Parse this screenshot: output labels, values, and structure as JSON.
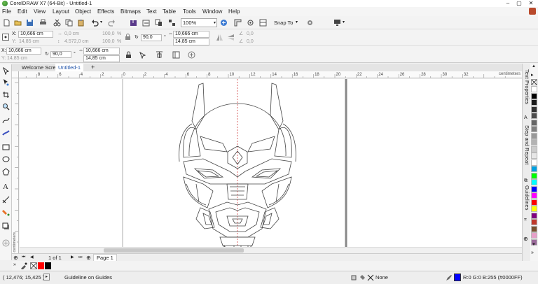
{
  "window": {
    "title": "CorelDRAW X7 (64-Bit) - Untitled-1"
  },
  "menu": [
    "File",
    "Edit",
    "View",
    "Layout",
    "Object",
    "Effects",
    "Bitmaps",
    "Text",
    "Table",
    "Tools",
    "Window",
    "Help"
  ],
  "toolbar": {
    "zoom_value": "100%",
    "snap_label": "Snap To"
  },
  "property_bar": {
    "x_label": "X:",
    "x_value": "10,666 cm",
    "y_label": "Y:",
    "y_value": "14,85 cm",
    "w_value": "0,0 cm",
    "h_value": "4.572,0 cm",
    "scale_w": "100,0",
    "scale_h": "100,0",
    "angle_value": "90,0",
    "x2_value": "10,666 cm",
    "y2_value": "14,85 cm",
    "skew_a": "0,0",
    "skew_b": "0,0"
  },
  "property_bar2": {
    "x_label": "X:",
    "x_value": "10,666 cm",
    "y_label": "Y:",
    "y_value": "14,85 cm",
    "angle_value": "90,0",
    "x2_value": "10,666 cm",
    "y2_value": "14,85 cm"
  },
  "doc_tabs": {
    "welcome": "Welcome Screen",
    "active": "Untitled-1",
    "add": "+"
  },
  "ruler": {
    "units": "centimeters",
    "h_ticks": [
      "8",
      "6",
      "4",
      "2",
      "0",
      "2",
      "4",
      "6",
      "8",
      "10",
      "12",
      "14",
      "16",
      "18",
      "20",
      "22",
      "24",
      "26",
      "28",
      "30",
      "32"
    ],
    "v_units": "centimeters"
  },
  "page_nav": {
    "counter": "1 of 1",
    "page_tab": "Page 1"
  },
  "status": {
    "coords": "( 12,476; 15,425 )",
    "message": "Guideline on Guides",
    "fill": "None",
    "outline": "R:0 G:0 B:255 (#0000FF)"
  },
  "dockers": [
    "Text Properties",
    "Step and Repeat",
    "Guidelines"
  ],
  "colors": {
    "guideline": "#d04040",
    "outline_swatch": "#0000ff",
    "palette": [
      "#ffffff",
      "#000000",
      "#1a1a1a",
      "#333333",
      "#4d4d4d",
      "#666666",
      "#808080",
      "#999999",
      "#b3b3b3",
      "#cccccc",
      "#e6e6e6",
      "#ffffff",
      "#00a0e0",
      "#00ff00",
      "#00ffff",
      "#0000ff",
      "#ff00ff",
      "#ff0000",
      "#ffff00",
      "#800080",
      "#c0392b",
      "#7a5230",
      "#e6a0c8",
      "#9a6a9a"
    ],
    "doc_palette": [
      "#ff0000",
      "#000000"
    ]
  }
}
